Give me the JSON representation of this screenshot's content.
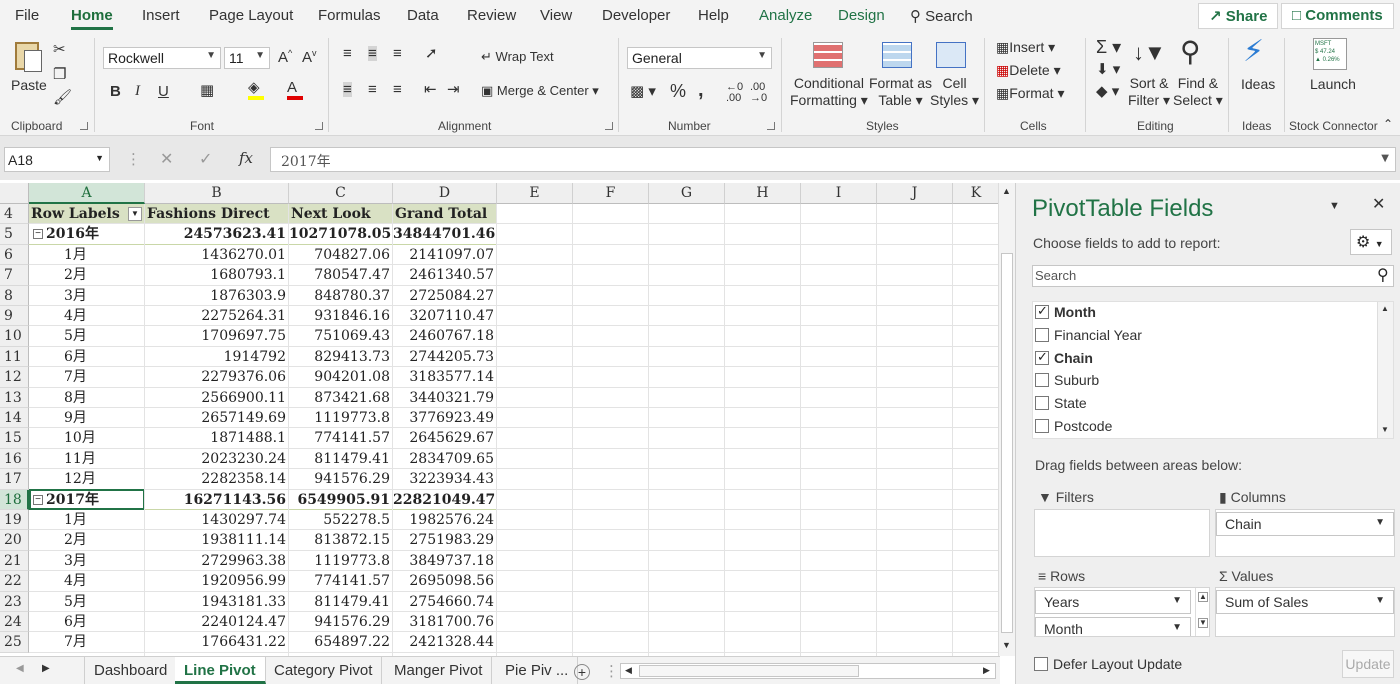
{
  "menu": {
    "tabs": [
      "File",
      "Home",
      "Insert",
      "Page Layout",
      "Formulas",
      "Data",
      "Review",
      "View",
      "Developer",
      "Help",
      "Analyze",
      "Design"
    ],
    "search": "Search",
    "share": "Share",
    "comments": "Comments"
  },
  "ribbon": {
    "paste": "Paste",
    "clipboard": "Clipboard",
    "font_name": "Rockwell",
    "font_size": "11",
    "font_group": "Font",
    "bold": "B",
    "italic": "I",
    "underline": "U",
    "wrap_text": "Wrap Text",
    "merge_center": "Merge & Center",
    "alignment": "Alignment",
    "number_format": "General",
    "percent": "%",
    "comma": ",",
    "number": "Number",
    "conditional": [
      "Conditional",
      "Formatting"
    ],
    "format_table": [
      "Format as",
      "Table"
    ],
    "cell_styles": [
      "Cell",
      "Styles"
    ],
    "styles": "Styles",
    "insert": "Insert",
    "delete": "Delete",
    "format": "Format",
    "cells": "Cells",
    "sort_filter": [
      "Sort &",
      "Filter"
    ],
    "find_select": [
      "Find &",
      "Select"
    ],
    "editing": "Editing",
    "ideas": "Ideas",
    "ideas_group": "Ideas",
    "launch": "Launch",
    "stock_connector": "Stock Connector",
    "stock_tile": [
      "MSFT",
      "$ 47.24",
      "▲ 0.26%"
    ]
  },
  "formula": {
    "cell_ref": "A18",
    "fx": "fx",
    "value": "2017年"
  },
  "grid": {
    "columns": [
      "A",
      "B",
      "C",
      "D",
      "E",
      "F",
      "G",
      "H",
      "I",
      "J",
      "K"
    ],
    "header_row": {
      "num": "4",
      "cells": [
        "Row Labels",
        "Fashions Direct",
        "Next Look",
        "Grand Total"
      ]
    },
    "rows": [
      {
        "num": "5",
        "label": "2016年",
        "b": "24573623.41",
        "c": "10271078.05",
        "d": "34844701.46",
        "bold": true,
        "group": true
      },
      {
        "num": "6",
        "label": "1月",
        "b": "1436270.01",
        "c": "704827.06",
        "d": "2141097.07"
      },
      {
        "num": "7",
        "label": "2月",
        "b": "1680793.1",
        "c": "780547.47",
        "d": "2461340.57"
      },
      {
        "num": "8",
        "label": "3月",
        "b": "1876303.9",
        "c": "848780.37",
        "d": "2725084.27"
      },
      {
        "num": "9",
        "label": "4月",
        "b": "2275264.31",
        "c": "931846.16",
        "d": "3207110.47"
      },
      {
        "num": "10",
        "label": "5月",
        "b": "1709697.75",
        "c": "751069.43",
        "d": "2460767.18"
      },
      {
        "num": "11",
        "label": "6月",
        "b": "1914792",
        "c": "829413.73",
        "d": "2744205.73"
      },
      {
        "num": "12",
        "label": "7月",
        "b": "2279376.06",
        "c": "904201.08",
        "d": "3183577.14"
      },
      {
        "num": "13",
        "label": "8月",
        "b": "2566900.11",
        "c": "873421.68",
        "d": "3440321.79"
      },
      {
        "num": "14",
        "label": "9月",
        "b": "2657149.69",
        "c": "1119773.8",
        "d": "3776923.49"
      },
      {
        "num": "15",
        "label": "10月",
        "b": "1871488.1",
        "c": "774141.57",
        "d": "2645629.67"
      },
      {
        "num": "16",
        "label": "11月",
        "b": "2023230.24",
        "c": "811479.41",
        "d": "2834709.65"
      },
      {
        "num": "17",
        "label": "12月",
        "b": "2282358.14",
        "c": "941576.29",
        "d": "3223934.43"
      },
      {
        "num": "18",
        "label": "2017年",
        "b": "16271143.56",
        "c": "6549905.91",
        "d": "22821049.47",
        "bold": true,
        "group": true
      },
      {
        "num": "19",
        "label": "1月",
        "b": "1430297.74",
        "c": "552278.5",
        "d": "1982576.24"
      },
      {
        "num": "20",
        "label": "2月",
        "b": "1938111.14",
        "c": "813872.15",
        "d": "2751983.29"
      },
      {
        "num": "21",
        "label": "3月",
        "b": "2729963.38",
        "c": "1119773.8",
        "d": "3849737.18"
      },
      {
        "num": "22",
        "label": "4月",
        "b": "1920956.99",
        "c": "774141.57",
        "d": "2695098.56"
      },
      {
        "num": "23",
        "label": "5月",
        "b": "1943181.33",
        "c": "811479.41",
        "d": "2754660.74"
      },
      {
        "num": "24",
        "label": "6月",
        "b": "2240124.47",
        "c": "941576.29",
        "d": "3181700.76"
      },
      {
        "num": "25",
        "label": "7月",
        "b": "1766431.22",
        "c": "654897.22",
        "d": "2421328.44"
      }
    ]
  },
  "sheets": [
    "Dashboard",
    "Line Pivot",
    "Category Pivot",
    "Manger Pivot",
    "Pie Piv ..."
  ],
  "pivot": {
    "title": "PivotTable Fields",
    "choose": "Choose fields to add to report:",
    "search_placeholder": "Search",
    "fields": [
      {
        "name": "Month",
        "checked": true
      },
      {
        "name": "Financial Year",
        "checked": false
      },
      {
        "name": "Chain",
        "checked": true
      },
      {
        "name": "Suburb",
        "checked": false
      },
      {
        "name": "State",
        "checked": false
      },
      {
        "name": "Postcode",
        "checked": false
      }
    ],
    "drag": "Drag fields between areas below:",
    "filters": "Filters",
    "columns": "Columns",
    "rows": "Rows",
    "values": "Values",
    "columns_item": "Chain",
    "rows_items": [
      "Years",
      "Month"
    ],
    "values_item": "Sum of Sales",
    "defer": "Defer Layout Update",
    "update": "Update"
  },
  "colors": {
    "accent": "#217346",
    "ribbon": "#f3f3f3",
    "header_fill": "#d9e1c4"
  }
}
